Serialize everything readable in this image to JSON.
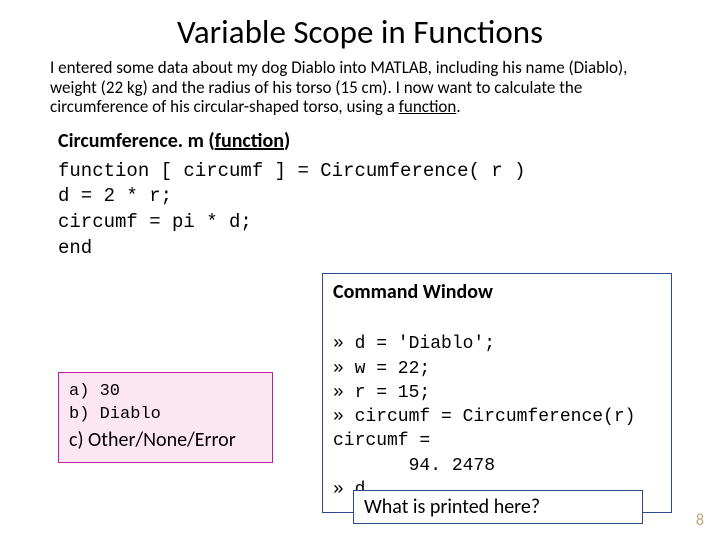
{
  "title": "Variable Scope in Functions",
  "intro_parts": {
    "p1": "I entered some data about my dog Diablo into MATLAB, including his name (Diablo), weight (22 kg) and the radius of his torso (15 cm). I now want to calculate the circumference of his circular-shaped torso, using a ",
    "p2": "function",
    "p3": "."
  },
  "subtitle_parts": {
    "s1": "Circumference. m (",
    "s2": "function",
    "s3": ")"
  },
  "code": {
    "l1": "function [ circumf ] = Circumference( r )",
    "l2": "d = 2 * r;",
    "l3": "circumf = pi * d;",
    "l4": "end"
  },
  "cmd": {
    "title": "Command Window",
    "l1": "» d = 'Diablo';",
    "l2": "» w = 22;",
    "l3": "» r = 15;",
    "l4": "» circumf = Circumference(r)",
    "l5": "circumf =",
    "l6": "       94. 2478",
    "l7": "» d"
  },
  "question": "What is printed here?",
  "answers": {
    "a": "a) 30",
    "b": "b) Diablo",
    "c": "c)  Other/None/Error"
  },
  "page_num": "8"
}
